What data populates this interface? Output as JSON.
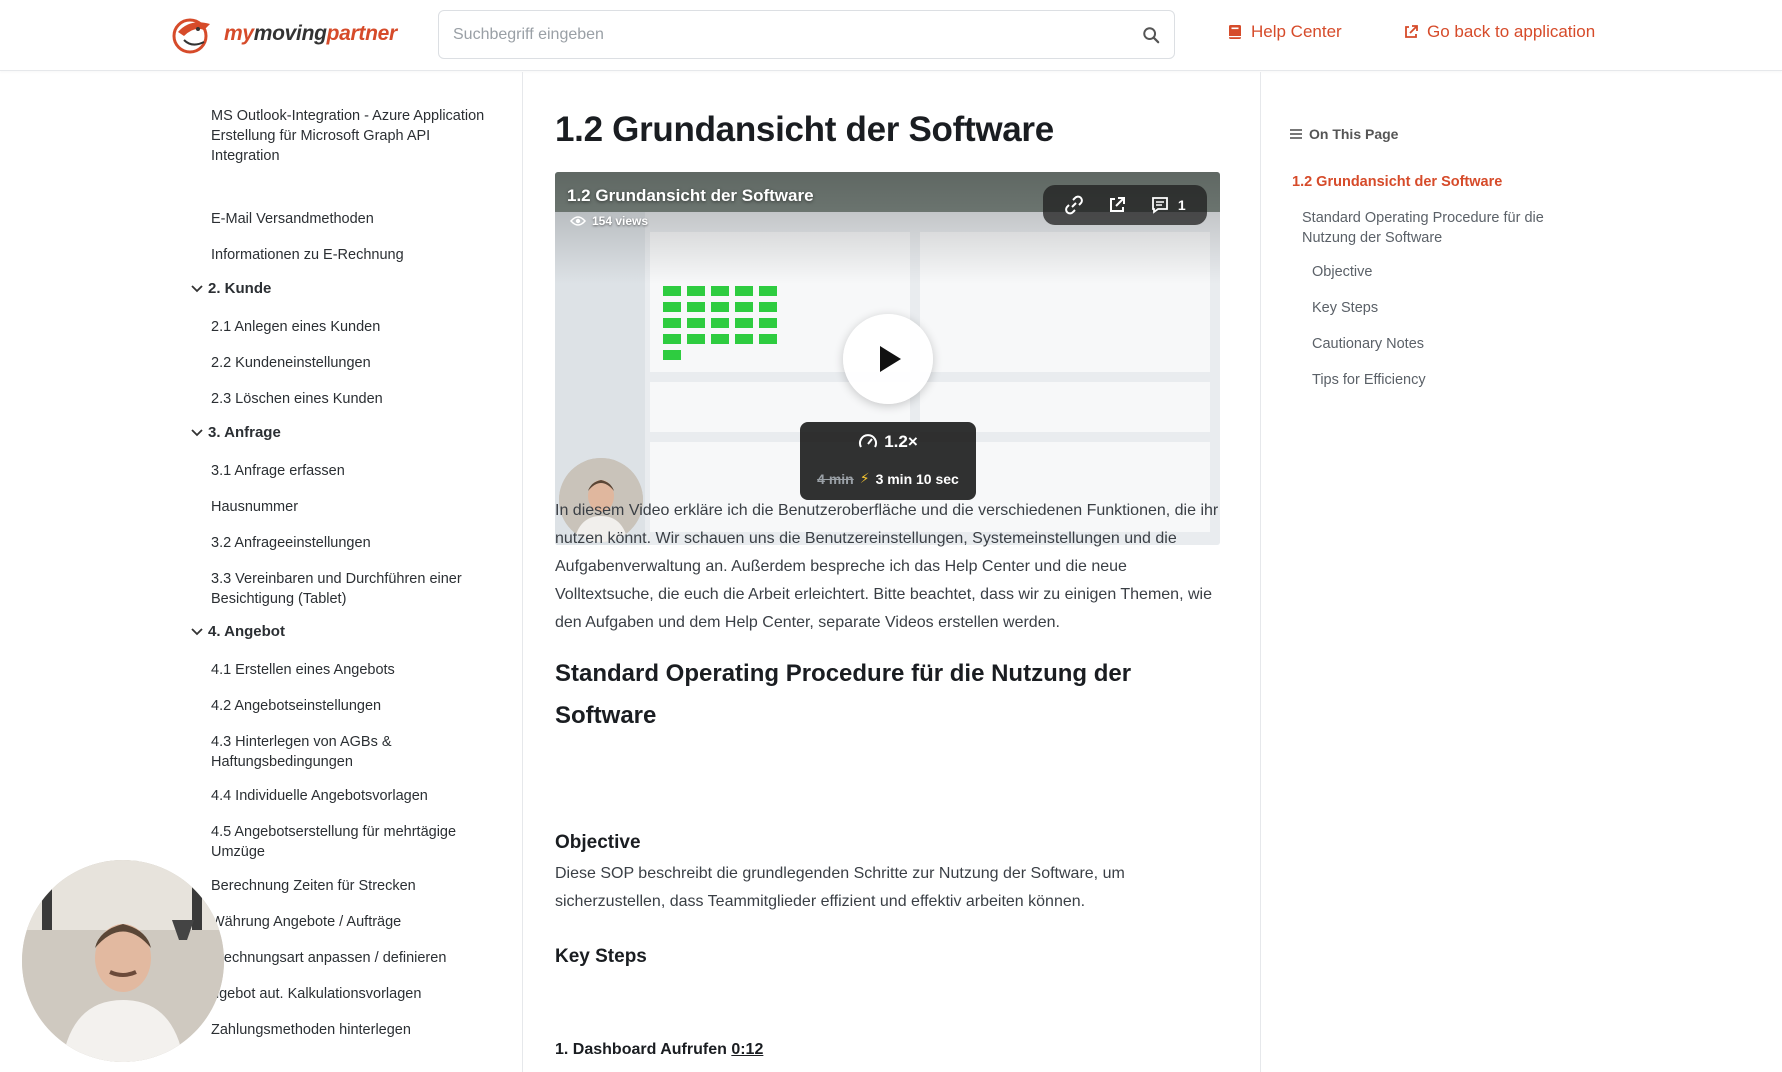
{
  "header": {
    "logo_part1": "my",
    "logo_part2": "moving",
    "logo_part3": "partner",
    "search_placeholder": "Suchbegriff eingeben",
    "help_center": "Help Center",
    "go_back": "Go back to application",
    "accent_color": "#d64b2a"
  },
  "sidebar": {
    "items": [
      {
        "type": "item",
        "label": "MS Outlook-Integration - Azure Application Erstellung für Microsoft Graph API Integration"
      },
      {
        "type": "item",
        "label": "E-Mail Versandmethoden"
      },
      {
        "type": "item",
        "label": "Informationen zu E-Rechnung"
      },
      {
        "type": "section",
        "label": "2. Kunde"
      },
      {
        "type": "item",
        "label": "2.1 Anlegen eines Kunden"
      },
      {
        "type": "item",
        "label": "2.2 Kundeneinstellungen"
      },
      {
        "type": "item",
        "label": "2.3 Löschen eines Kunden"
      },
      {
        "type": "section",
        "label": "3. Anfrage"
      },
      {
        "type": "item",
        "label": "3.1 Anfrage erfassen"
      },
      {
        "type": "item",
        "label": "Hausnummer"
      },
      {
        "type": "item",
        "label": "3.2 Anfrageeinstellungen"
      },
      {
        "type": "item",
        "label": "3.3 Vereinbaren und Durchführen einer Besichtigung (Tablet)"
      },
      {
        "type": "section",
        "label": "4. Angebot"
      },
      {
        "type": "item",
        "label": "4.1 Erstellen eines Angebots"
      },
      {
        "type": "item",
        "label": "4.2 Angebotseinstellungen"
      },
      {
        "type": "item",
        "label": "4.3 Hinterlegen von AGBs & Haftungsbedingungen"
      },
      {
        "type": "item",
        "label": "4.4 Individuelle Angebotsvorlagen"
      },
      {
        "type": "item",
        "label": "4.5 Angebotserstellung für mehrtägige Umzüge"
      },
      {
        "type": "item",
        "label": "Berechnung Zeiten für Strecken"
      },
      {
        "type": "item",
        "label": "Währung Angebote / Aufträge"
      },
      {
        "type": "item",
        "label": "brechnungsart anpassen / definieren"
      },
      {
        "type": "item",
        "label": "ngebot aut. Kalkulationsvorlagen"
      },
      {
        "type": "item",
        "label": "Zahlungsmethoden hinterlegen"
      }
    ]
  },
  "main": {
    "title": "1.2 Grundansicht der Software",
    "video": {
      "title": "1.2 Grundansicht der Software",
      "views": "154 views",
      "comments_count": "1",
      "speed": "1.2×",
      "old_time": "4 min",
      "new_time": "3 min 10 sec"
    },
    "intro": "In diesem Video erkläre ich die Benutzeroberfläche und die verschiedenen Funktionen, die ihr nutzen könnt. Wir schauen uns die Benutzereinstellungen, Systemeinstellungen und die Aufgabenverwaltung an. Außerdem bespreche ich das Help Center und die neue Volltextsuche, die euch die Arbeit erleichtert. Bitte beachtet, dass wir zu einigen Themen, wie den Aufgaben und dem Help Center, separate Videos erstellen werden.",
    "sop_heading": "Standard Operating Procedure für die Nutzung der Software",
    "objective_heading": "Objective",
    "objective_text": "Diese SOP beschreibt die grundlegenden Schritte zur Nutzung der Software, um sicherzustellen, dass Teammitglieder effizient und effektiv arbeiten können.",
    "key_steps_heading": "Key Steps",
    "step1_label": "1. Dashboard Aufrufen",
    "step1_time": "0:12"
  },
  "toc": {
    "heading": "On This Page",
    "items": [
      {
        "label": "1.2 Grundansicht der Software",
        "active": true
      },
      {
        "label": "Standard Operating Procedure für die Nutzung der Software"
      },
      {
        "label": "Objective"
      },
      {
        "label": "Key Steps"
      },
      {
        "label": "Cautionary Notes"
      },
      {
        "label": "Tips for Efficiency"
      }
    ]
  }
}
